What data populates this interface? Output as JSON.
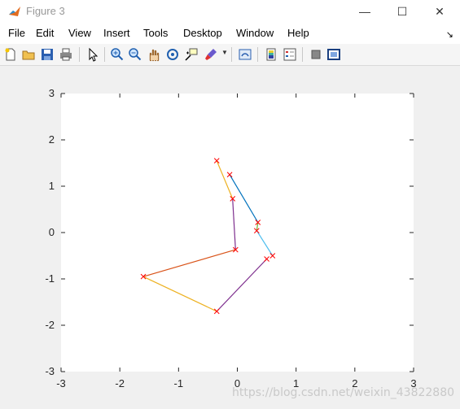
{
  "window": {
    "title": "Figure 3"
  },
  "menu": {
    "items": [
      "File",
      "Edit",
      "View",
      "Insert",
      "Tools",
      "Desktop",
      "Window",
      "Help"
    ]
  },
  "toolbar": {
    "buttons": [
      "new-figure",
      "open-file",
      "save",
      "print",
      "edit-plot",
      "zoom-in",
      "zoom-out",
      "pan",
      "rotate-3d",
      "data-cursor",
      "brush",
      "link-plot",
      "insert-colorbar",
      "insert-legend",
      "hide-plot-tools",
      "show-plot-tools"
    ]
  },
  "watermark": "https://blog.csdn.net/weixin_43822880",
  "chart_data": {
    "type": "line",
    "title": "",
    "xlabel": "",
    "ylabel": "",
    "xlim": [
      -3,
      3
    ],
    "ylim": [
      -3,
      3
    ],
    "xticks": [
      -3,
      -2,
      -1,
      0,
      1,
      2,
      3
    ],
    "yticks": [
      -3,
      -2,
      -1,
      0,
      1,
      2,
      3
    ],
    "grid": false,
    "marker": "x",
    "marker_color": "#ff0000",
    "series": [
      {
        "color": "#0072bd",
        "points": [
          [
            -0.13,
            1.25
          ],
          [
            0.35,
            0.22
          ]
        ]
      },
      {
        "color": "#4dbeee",
        "points": [
          [
            0.33,
            0.04
          ],
          [
            0.6,
            -0.5
          ]
        ]
      },
      {
        "color": "#edb120",
        "points": [
          [
            -0.35,
            1.55
          ],
          [
            -0.08,
            0.73
          ]
        ]
      },
      {
        "color": "#7e2f8e",
        "points": [
          [
            -0.08,
            0.73
          ],
          [
            -0.03,
            -0.37
          ]
        ]
      },
      {
        "color": "#d95319",
        "points": [
          [
            -0.03,
            -0.37
          ],
          [
            -1.6,
            -0.95
          ]
        ]
      },
      {
        "color": "#edb120",
        "points": [
          [
            -1.6,
            -0.95
          ],
          [
            -0.35,
            -1.7
          ]
        ]
      },
      {
        "color": "#7e2f8e",
        "points": [
          [
            -0.35,
            -1.7
          ],
          [
            0.5,
            -0.57
          ]
        ]
      },
      {
        "color": "#77ac30",
        "points": [
          [
            0.35,
            0.22
          ],
          [
            0.33,
            0.04
          ]
        ]
      }
    ],
    "markers": [
      [
        -0.35,
        1.55
      ],
      [
        -0.13,
        1.25
      ],
      [
        -0.08,
        0.73
      ],
      [
        0.35,
        0.22
      ],
      [
        0.33,
        0.04
      ],
      [
        -0.03,
        -0.37
      ],
      [
        0.6,
        -0.5
      ],
      [
        0.5,
        -0.57
      ],
      [
        -1.6,
        -0.95
      ],
      [
        -0.35,
        -1.7
      ]
    ]
  }
}
